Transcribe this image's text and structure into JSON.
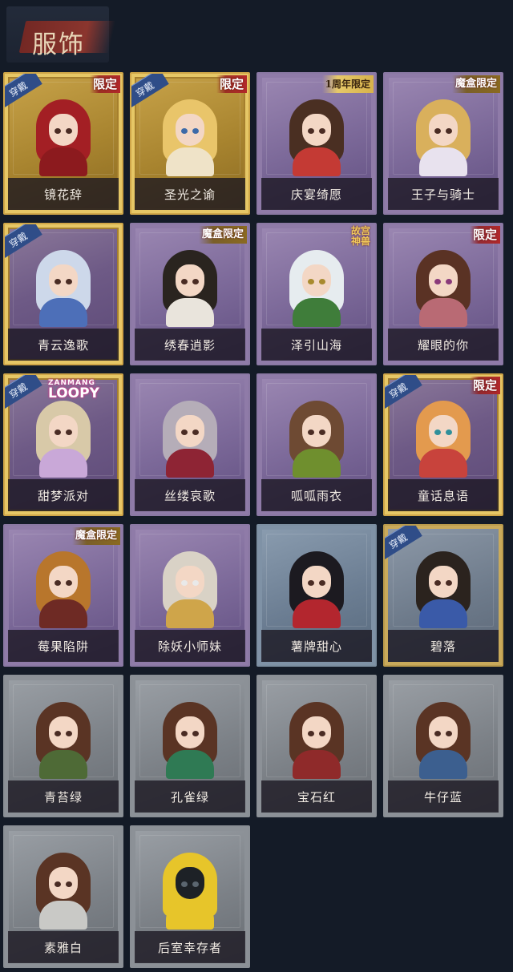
{
  "header": {
    "title": "服饰"
  },
  "badges": {
    "wear": "穿戴",
    "limited": "限定",
    "box_limited": "魔盒限定",
    "anniv_limited": "1周年限定",
    "palace_line1": "故宫",
    "palace_line2": "神兽",
    "loopy_top": "ZANMANG",
    "loopy_main": "LOOPY"
  },
  "colors": {
    "background": "#141b27",
    "gold_frame": "#cfa648",
    "wear_badge": "#2f4d88",
    "limit_badge": "#b2282a"
  },
  "costumes": [
    {
      "name": "镜花辞",
      "frame": "gold"
    },
    {
      "name": "圣光之谕",
      "frame": "gold"
    },
    {
      "name": "庆宴绮愿",
      "frame": "purple"
    },
    {
      "name": "王子与骑士",
      "frame": "purple"
    },
    {
      "name": "青云逸歌",
      "frame": "gold"
    },
    {
      "name": "绣春逍影",
      "frame": "purple"
    },
    {
      "name": "泽引山海",
      "frame": "purple"
    },
    {
      "name": "耀眼的你",
      "frame": "purple"
    },
    {
      "name": "甜梦派对",
      "frame": "gold"
    },
    {
      "name": "丝缕哀歌",
      "frame": "purple"
    },
    {
      "name": "呱呱雨衣",
      "frame": "purple"
    },
    {
      "name": "童话息语",
      "frame": "gold"
    },
    {
      "name": "莓果陷阱",
      "frame": "purple"
    },
    {
      "name": "除妖小师妹",
      "frame": "purple"
    },
    {
      "name": "薯牌甜心",
      "frame": "blue"
    },
    {
      "name": "碧落",
      "frame": "gold"
    },
    {
      "name": "青苔绿",
      "frame": "gray"
    },
    {
      "name": "孔雀绿",
      "frame": "gray"
    },
    {
      "name": "宝石红",
      "frame": "gray"
    },
    {
      "name": "牛仔蓝",
      "frame": "gray"
    },
    {
      "name": "素雅白",
      "frame": "gray"
    },
    {
      "name": "后室幸存者",
      "frame": "gray"
    }
  ]
}
